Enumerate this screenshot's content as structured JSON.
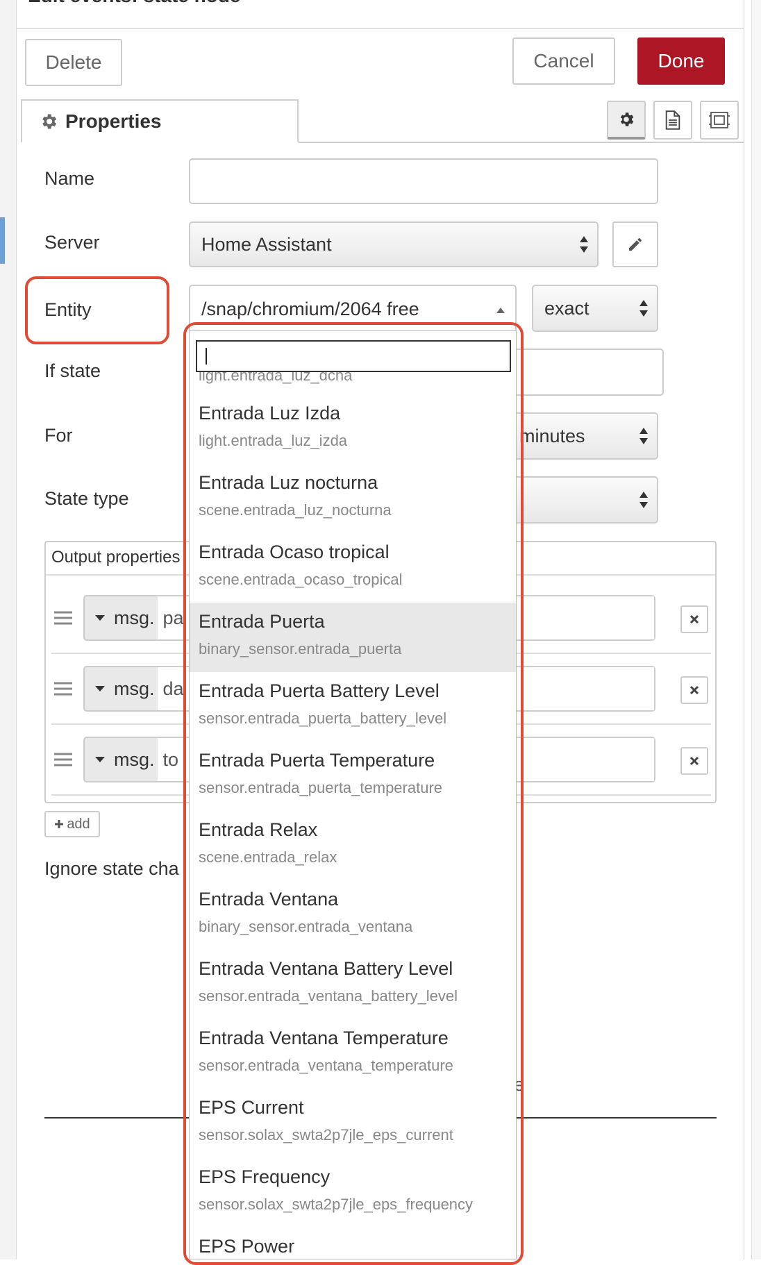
{
  "dialog": {
    "title": "Edit events: state node",
    "buttons": {
      "delete": "Delete",
      "cancel": "Cancel",
      "done": "Done"
    },
    "tab": {
      "label": "Properties"
    }
  },
  "form": {
    "name_label": "Name",
    "name_value": "",
    "server_label": "Server",
    "server_value": "Home Assistant",
    "entity_label": "Entity",
    "entity_value": "/snap/chromium/2064 free",
    "match_value": "exact",
    "if_state_label": "If state",
    "for_label": "For",
    "for_unit": "minutes",
    "state_type_label": "State type",
    "output_properties_label": "Output properties",
    "output_rows": [
      {
        "prefix": "msg.",
        "value": "pa"
      },
      {
        "prefix": "msg.",
        "value": "da"
      },
      {
        "prefix": "msg.",
        "value": "to"
      }
    ],
    "add_label": "add",
    "ignore_label": "Ignore state cha",
    "hidden_fragment": "e"
  },
  "dropdown": {
    "search_value": "",
    "partial_top": "light.entrada_luz_dcha",
    "items": [
      {
        "name": "Entrada Luz Izda",
        "id": "light.entrada_luz_izda"
      },
      {
        "name": "Entrada Luz nocturna",
        "id": "scene.entrada_luz_nocturna"
      },
      {
        "name": "Entrada Ocaso tropical",
        "id": "scene.entrada_ocaso_tropical"
      },
      {
        "name": "Entrada Puerta",
        "id": "binary_sensor.entrada_puerta",
        "highlighted": true
      },
      {
        "name": "Entrada Puerta Battery Level",
        "id": "sensor.entrada_puerta_battery_level"
      },
      {
        "name": "Entrada Puerta Temperature",
        "id": "sensor.entrada_puerta_temperature"
      },
      {
        "name": "Entrada Relax",
        "id": "scene.entrada_relax"
      },
      {
        "name": "Entrada Ventana",
        "id": "binary_sensor.entrada_ventana"
      },
      {
        "name": "Entrada Ventana Battery Level",
        "id": "sensor.entrada_ventana_battery_level"
      },
      {
        "name": "Entrada Ventana Temperature",
        "id": "sensor.entrada_ventana_temperature"
      },
      {
        "name": "EPS Current",
        "id": "sensor.solax_swta2p7jle_eps_current"
      },
      {
        "name": "EPS Frequency",
        "id": "sensor.solax_swta2p7jle_eps_frequency"
      },
      {
        "name": "EPS Power",
        "id": ""
      }
    ]
  },
  "colors": {
    "done": "#ad1625",
    "annotation": "#e04b36",
    "highlight_row": "#e8e8e8"
  },
  "icons": [
    "gear-icon",
    "document-icon",
    "frame-icon",
    "pencil-icon",
    "updown-arrows-icon",
    "caret-down-icon",
    "drag-handle-icon",
    "close-icon",
    "plus-icon"
  ]
}
